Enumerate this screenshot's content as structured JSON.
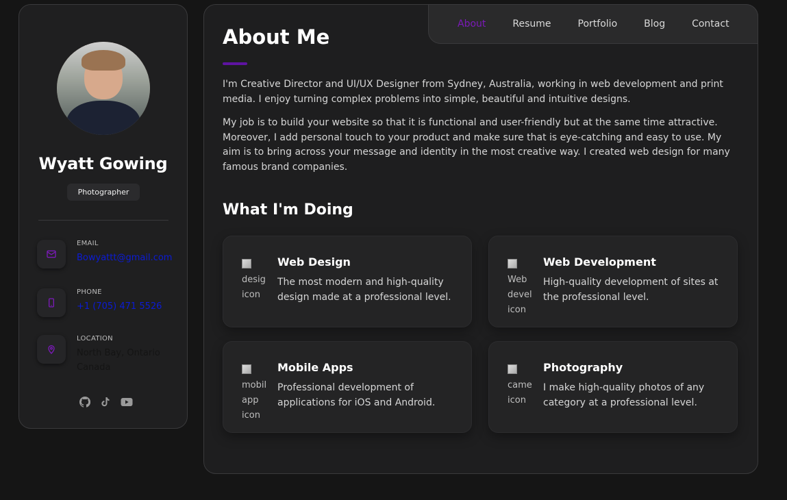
{
  "profile": {
    "name": "Wyatt Gowing",
    "role": "Photographer"
  },
  "contacts": {
    "email": {
      "label": "EMAIL",
      "value": "Bowyattt@gmail.com"
    },
    "phone": {
      "label": "PHONE",
      "value": "+1 (705) 471 5526"
    },
    "location": {
      "label": "LOCATION",
      "value": "North Bay, Ontario Canada"
    }
  },
  "socials": [
    "github-icon",
    "tiktok-icon",
    "youtube-icon"
  ],
  "nav": {
    "items": [
      {
        "label": "About",
        "active": true
      },
      {
        "label": "Resume",
        "active": false
      },
      {
        "label": "Portfolio",
        "active": false
      },
      {
        "label": "Blog",
        "active": false
      },
      {
        "label": "Contact",
        "active": false
      }
    ]
  },
  "about": {
    "title": "About Me",
    "paragraphs": [
      "I'm Creative Director and UI/UX Designer from Sydney, Australia, working in web development and print media. I enjoy turning complex problems into simple, beautiful and intuitive designs.",
      "My job is to build your website so that it is functional and user-friendly but at the same time attractive. Moreover, I add personal touch to your product and make sure that is eye-catching and easy to use. My aim is to bring across your message and identity in the most creative way. I created web design for many famous brand companies."
    ]
  },
  "services": {
    "title": "What I'm Doing",
    "items": [
      {
        "title": "Web Design",
        "desc": "The most modern and high-quality design made at a professional level.",
        "alt": "design icon"
      },
      {
        "title": "Web Development",
        "desc": "High-quality development of sites at the professional level.",
        "alt": "Web development icon"
      },
      {
        "title": "Mobile Apps",
        "desc": "Professional development of applications for iOS and Android.",
        "alt": "mobile app icon"
      },
      {
        "title": "Photography",
        "desc": "I make high-quality photos of any category at a professional level.",
        "alt": "camera icon"
      }
    ]
  },
  "colors": {
    "accent": "#7b1ab8",
    "accent_bar": "#5e13a1",
    "link": "#0b1bd6"
  }
}
